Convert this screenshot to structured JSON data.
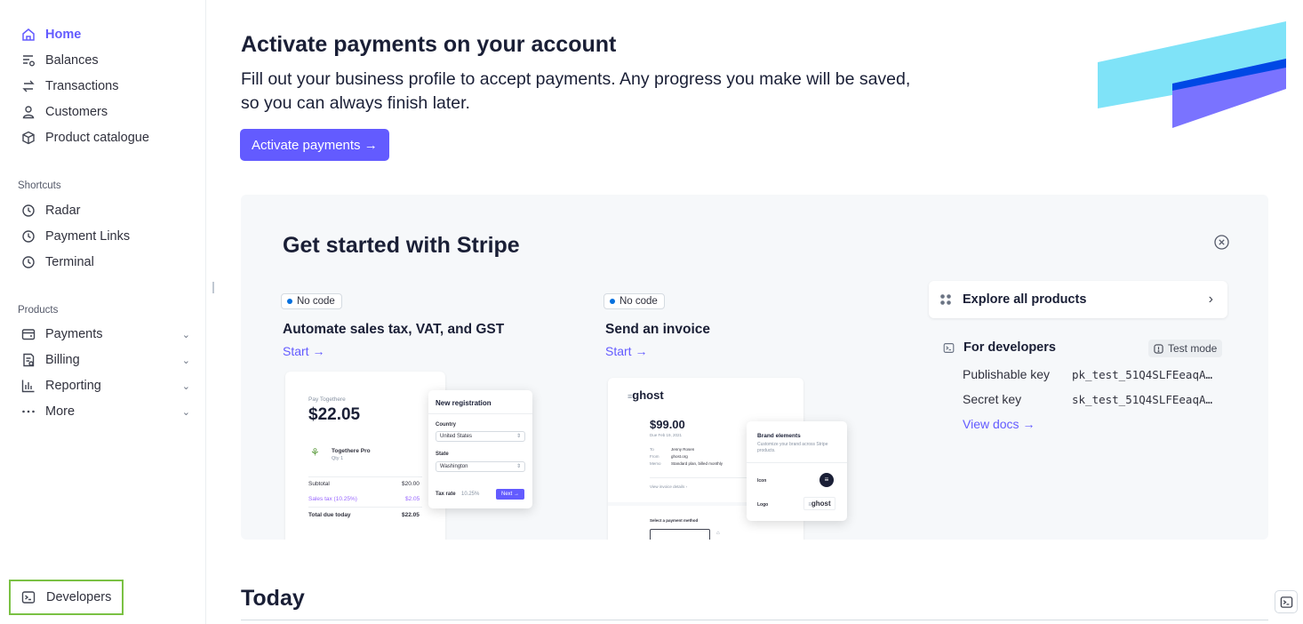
{
  "sidebar": {
    "nav": [
      {
        "label": "Home",
        "icon": "home-icon"
      },
      {
        "label": "Balances",
        "icon": "balances-icon"
      },
      {
        "label": "Transactions",
        "icon": "transactions-icon"
      },
      {
        "label": "Customers",
        "icon": "customers-icon"
      },
      {
        "label": "Product catalogue",
        "icon": "product-icon"
      }
    ],
    "shortcuts_label": "Shortcuts",
    "shortcuts": [
      {
        "label": "Radar",
        "icon": "clock-icon"
      },
      {
        "label": "Payment Links",
        "icon": "clock-icon"
      },
      {
        "label": "Terminal",
        "icon": "clock-icon"
      }
    ],
    "products_label": "Products",
    "products": [
      {
        "label": "Payments",
        "icon": "payments-icon"
      },
      {
        "label": "Billing",
        "icon": "billing-icon"
      },
      {
        "label": "Reporting",
        "icon": "reporting-icon"
      },
      {
        "label": "More",
        "icon": "more-icon"
      }
    ],
    "developers_label": "Developers"
  },
  "header": {
    "title": "Activate payments on your account",
    "subtitle": "Fill out your business profile to accept payments. Any progress you make will be saved, so you can always finish later.",
    "activate_label": "Activate payments →"
  },
  "get_started": {
    "title": "Get started with Stripe",
    "features": [
      {
        "pill": "No code",
        "title": "Automate sales tax, VAT, and GST",
        "start": "Start →"
      },
      {
        "pill": "No code",
        "title": "Send an invoice",
        "start": "Start →"
      }
    ],
    "tax_mock": {
      "pay_label": "Pay Togethere",
      "amount": "$22.05",
      "product": "Togethere Pro",
      "qty": "Qty 1",
      "subtotal_label": "Subtotal",
      "subtotal": "$20.00",
      "tax_label": "Sales tax (10.25%)",
      "tax": "$2.05",
      "total_label": "Total due today",
      "total": "$22.05",
      "panel_title": "New registration",
      "country_label": "Country",
      "country": "United States",
      "state_label": "State",
      "state": "Washington",
      "rate_label": "Tax rate",
      "rate": "10.25%",
      "next": "Next →"
    },
    "invoice_mock": {
      "brand": "ghost",
      "amount": "$99.00",
      "due": "Due Feb 19, 2021",
      "to_label": "To",
      "to": "Jenny Rosen",
      "from_label": "From",
      "from": "ghost.org",
      "memo_label": "Memo",
      "memo": "Standard plan, billed monthly",
      "view_details": "View invoice details",
      "payment_method": "Select a payment method",
      "panel_title": "Brand elements",
      "panel_desc": "Customize your brand across Stripe products.",
      "icon_label": "Icon",
      "logo_label": "Logo"
    },
    "explore_label": "Explore all products",
    "developers": {
      "title": "For developers",
      "test_mode": "Test mode",
      "publishable_label": "Publishable key",
      "publishable_value": "pk_test_51Q4SLFEeaqA…",
      "secret_label": "Secret key",
      "secret_value": "sk_test_51Q4SLFEeaqA…",
      "docs_label": "View docs →"
    }
  },
  "today_label": "Today",
  "colors": {
    "accent": "#635bff",
    "highlight_border": "#7ac143",
    "banner_cyan": "#7fe3f8",
    "banner_purple": "#7a73ff",
    "banner_blue": "#0048e5"
  }
}
